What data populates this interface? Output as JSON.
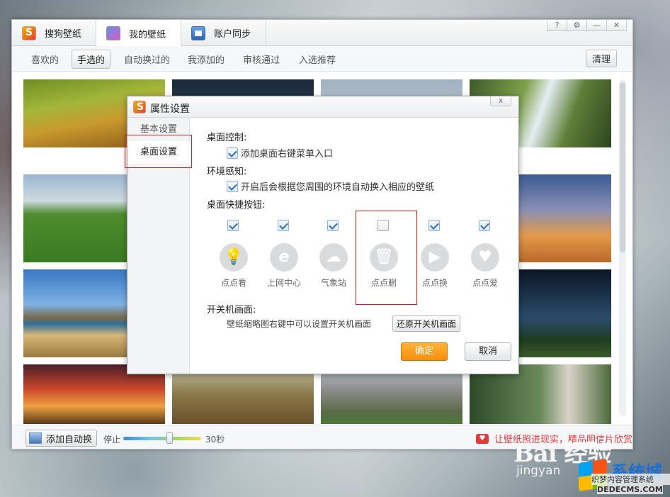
{
  "tabs": [
    {
      "label": "搜狗壁纸",
      "icon": "sogou-logo-icon"
    },
    {
      "label": "我的壁纸",
      "icon": "my-wallpaper-icon"
    },
    {
      "label": "账户同步",
      "icon": "account-card-icon"
    }
  ],
  "window_buttons": [
    "?",
    "⚙",
    "—",
    "✕"
  ],
  "subtabs": [
    "喜欢的",
    "手选的",
    "自动换过的",
    "我添加的",
    "审核通过",
    "入选推荐"
  ],
  "selected_subtab": "手选的",
  "clean_label": "清理",
  "footer": {
    "auto_button": "添加自动换",
    "stop_label": "停止",
    "interval_label": "30秒",
    "slider_value": 0.6,
    "promo_text": "让壁纸照进现实，精品明信片欣赏"
  },
  "dialog": {
    "title": "属性设置",
    "close": "x",
    "nav": [
      "基本设置",
      "桌面设置"
    ],
    "selected_nav": "桌面设置",
    "desktop_control": {
      "heading": "桌面控制:",
      "option": "添加桌面右键菜单入口",
      "checked": true
    },
    "env_sense": {
      "heading": "环境感知:",
      "option": "开启后会根据您周围的环境自动换入相应的壁纸",
      "checked": true
    },
    "quick_buttons": {
      "heading": "桌面快捷按钮:",
      "items": [
        {
          "label": "点点看",
          "icon": "lightbulb-icon",
          "glyph": "💡",
          "checked": true
        },
        {
          "label": "上网中心",
          "icon": "ie-browser-icon",
          "glyph": "e",
          "checked": true
        },
        {
          "label": "气象站",
          "icon": "weather-icon",
          "glyph": "☁",
          "checked": true
        },
        {
          "label": "点点删",
          "icon": "trash-icon",
          "glyph": "🗑",
          "checked": false
        },
        {
          "label": "点点换",
          "icon": "next-icon",
          "glyph": "▶",
          "checked": true
        },
        {
          "label": "点点爱",
          "icon": "heart-icon",
          "glyph": "♥",
          "checked": true
        }
      ]
    },
    "boot_screen": {
      "heading": "开关机画面:",
      "hint": "壁纸缩略图右键中可以设置开关机画面",
      "restore_button": "还原开关机画面"
    },
    "ok": "确定",
    "cancel": "取消"
  },
  "watermark": {
    "baidu": "Bai 经验",
    "jingyan": "jingyan",
    "xitong": "系统城",
    "site_cn": "织梦内容管理系统",
    "site_url": "DEDECMS.COM"
  }
}
